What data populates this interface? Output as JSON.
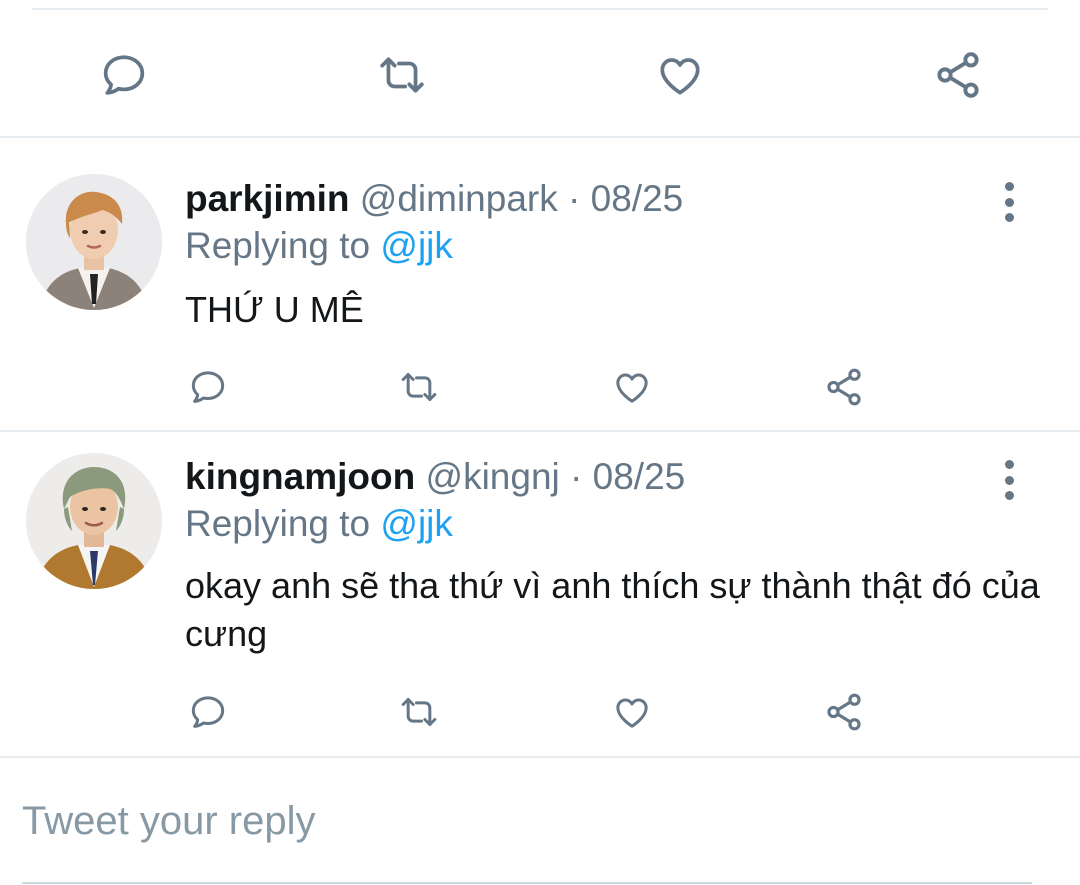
{
  "main_tweet_actions": {
    "icons": [
      "comment-icon",
      "retweet-icon",
      "like-icon",
      "share-icon"
    ]
  },
  "replies": [
    {
      "display_name": "parkjimin",
      "handle": "@diminpark",
      "separator": " · ",
      "date": "08/25",
      "replying_prefix": "Replying to ",
      "replying_to": "@jjk",
      "text": "THỨ U MÊ"
    },
    {
      "display_name": "kingnamjoon",
      "handle": "@kingnj",
      "separator": " · ",
      "date": "08/25",
      "replying_prefix": "Replying to ",
      "replying_to": "@jjk",
      "text": "okay anh sẽ tha thứ vì anh thích sự thành thật đó của cưng"
    }
  ],
  "compose": {
    "placeholder": "Tweet your reply"
  },
  "colors": {
    "text_primary": "#14171a",
    "text_secondary": "#657786",
    "accent": "#1da1f2",
    "divider": "#e6ecf0"
  }
}
